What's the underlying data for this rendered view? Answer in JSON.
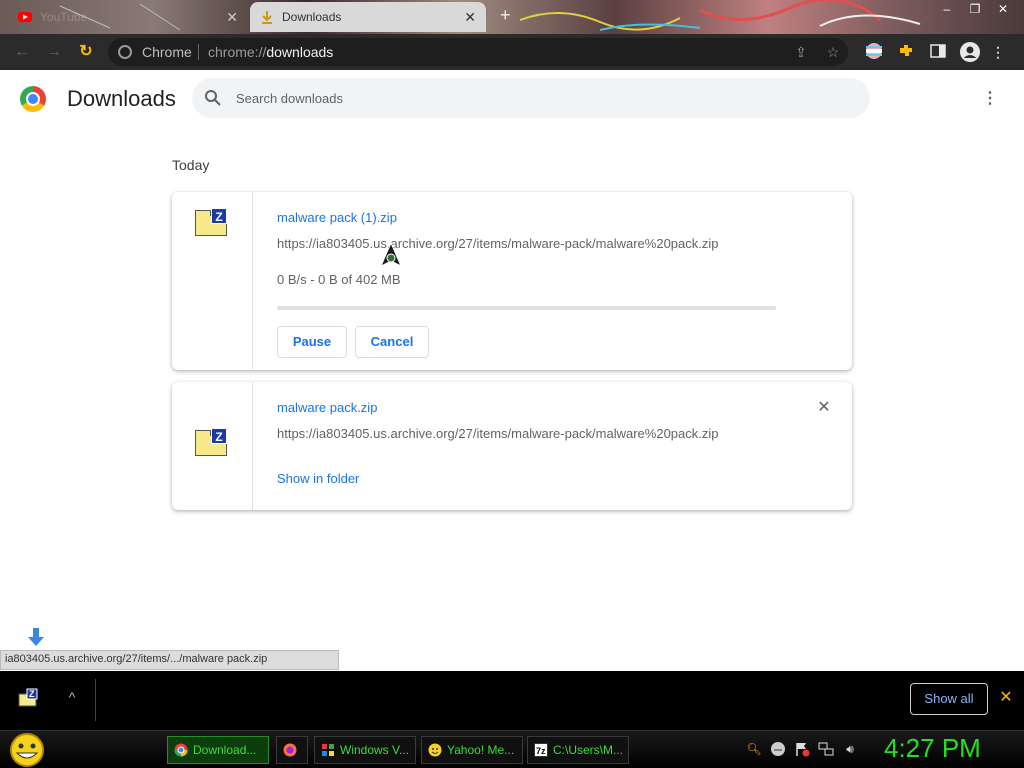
{
  "browser": {
    "tabs": [
      {
        "title": "YouTube",
        "active": false
      },
      {
        "title": "Downloads",
        "active": true
      }
    ],
    "new_tab_symbol": "+",
    "window_controls": [
      "–",
      "❐",
      "✕"
    ],
    "omnibox": {
      "site_label": "Chrome",
      "url_prefix": "chrome://",
      "url_path": "downloads"
    }
  },
  "page": {
    "title": "Downloads",
    "search_placeholder": "Search downloads",
    "menu_symbol": "⋮",
    "section_date": "Today"
  },
  "downloads": [
    {
      "filename": "malware pack (1).zip",
      "url": "https://ia803405.us.archive.org/27/items/malware-pack/malware%20pack.zip",
      "status": "0 B/s - 0 B of 402 MB",
      "progress": 0,
      "pause_label": "Pause",
      "cancel_label": "Cancel"
    },
    {
      "filename": "malware pack.zip",
      "url": "https://ia803405.us.archive.org/27/items/malware-pack/malware%20pack.zip",
      "show_in_folder_label": "Show in folder",
      "remove_symbol": "✕"
    }
  ],
  "status_bubble": "ia803405.us.archive.org/27/items/.../malware pack.zip",
  "shelf": {
    "show_all_label": "Show all",
    "close_symbol": "✕",
    "chevron_symbol": "^"
  },
  "taskbar": {
    "buttons": [
      {
        "label": "Download...",
        "icon": "chrome-icon",
        "active": true
      },
      {
        "label": "",
        "icon": "firefox-icon",
        "active": false
      },
      {
        "label": "Windows V...",
        "icon": "windows-icon",
        "active": false
      },
      {
        "label": "Yahoo! Me...",
        "icon": "yahoo-messenger-icon",
        "active": false
      },
      {
        "label": "C:\\Users\\M...",
        "icon": "7zip-icon",
        "active": false
      }
    ],
    "clock": "4:27 PM"
  },
  "colors": {
    "link_blue": "#1a73e8",
    "clock_green": "#22e022",
    "taskbar_text": "#3ddc3d"
  }
}
